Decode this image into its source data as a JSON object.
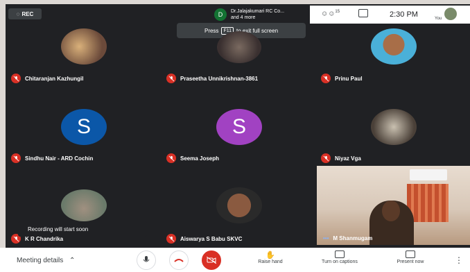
{
  "rec_label": "REC",
  "presenter": {
    "initial": "D",
    "line1": "Dr.Jalajakumari RC Co...",
    "line2": "and 4 more"
  },
  "topbar": {
    "people_count": "15",
    "time": "2:30 PM",
    "self_label": "You"
  },
  "fullscreen_notice": {
    "prefix": "Press",
    "key": "F11",
    "suffix": "to exit full screen"
  },
  "participants": [
    {
      "name": "Chitaranjan Kazhungil"
    },
    {
      "name": "Praseetha Unnikrishnan-3861"
    },
    {
      "name": "Prinu Paul"
    },
    {
      "name": "Sindhu Nair - ARD Cochin",
      "initial": "S"
    },
    {
      "name": "Seema Joseph",
      "initial": "S"
    },
    {
      "name": "Niyaz Vga"
    },
    {
      "name": "K R Chandrika"
    },
    {
      "name": "Aiswarya S Babu SKVC"
    },
    {
      "name": "M Shanmugam"
    }
  ],
  "toast": "Recording will start soon",
  "bottombar": {
    "meeting_details": "Meeting details",
    "raise_hand": "Raise hand",
    "captions": "Turn on captions",
    "present": "Present now"
  },
  "colors": {
    "blue_avatar": "#0b57a8",
    "purple_avatar": "#a142c2",
    "mic_off": "#d93025",
    "bg": "#202124"
  }
}
